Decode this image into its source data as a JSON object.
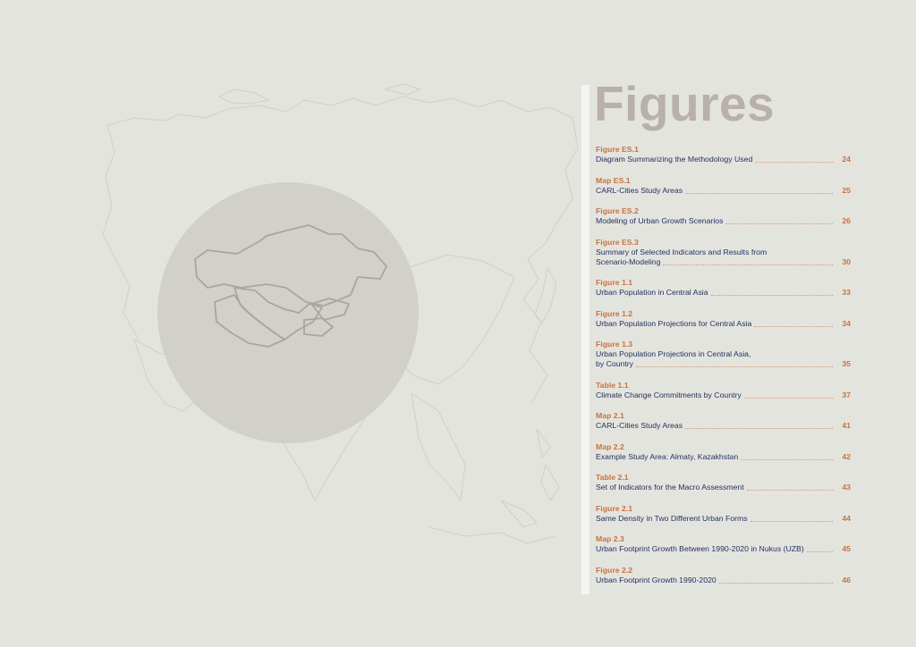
{
  "heading": "Figures",
  "colors": {
    "background": "#e4e4df",
    "label": "#c8733f",
    "title_text": "#1f2f5c",
    "heading": "#b9b0aa"
  },
  "entries": [
    {
      "label": "Figure ES.1",
      "lines": [
        "Diagram Summarizing the Methodology Used"
      ],
      "page": "24"
    },
    {
      "label": "Map ES.1",
      "lines": [
        "CARL-Cities Study Areas"
      ],
      "page": "25"
    },
    {
      "label": "Figure ES.2",
      "lines": [
        "Modeling of Urban Growth Scenarios"
      ],
      "page": "26"
    },
    {
      "label": "Figure ES.3",
      "lines": [
        "Summary of Selected Indicators and Results from",
        "Scenario-Modeling"
      ],
      "page": "30"
    },
    {
      "label": "Figure 1.1",
      "lines": [
        "Urban Population in Central Asia"
      ],
      "page": "33"
    },
    {
      "label": "Figure 1.2",
      "lines": [
        "Urban Population Projections for Central Asia"
      ],
      "page": "34"
    },
    {
      "label": "Figure 1.3",
      "lines": [
        "Urban Population Projections in Central Asia,",
        "by Country"
      ],
      "page": "35"
    },
    {
      "label": "Table 1.1",
      "lines": [
        "Climate Change Commitments by Country"
      ],
      "page": "37"
    },
    {
      "label": "Map 2.1",
      "lines": [
        "CARL-Cities Study Areas"
      ],
      "page": "41"
    },
    {
      "label": "Map 2.2",
      "lines": [
        "Example Study Area: Almaty, Kazakhstan"
      ],
      "page": "42"
    },
    {
      "label": "Table 2.1",
      "lines": [
        "Set of Indicators for the Macro Assessment"
      ],
      "page": "43"
    },
    {
      "label": "Figure 2.1",
      "lines": [
        "Same Density in Two Different Urban Forms"
      ],
      "page": "44"
    },
    {
      "label": "Map 2.3",
      "lines": [
        "Urban Footprint Growth Between 1990-2020 in Nukus (UZB)"
      ],
      "page": "45"
    },
    {
      "label": "Figure 2.2",
      "lines": [
        "Urban Footprint Growth 1990-2020"
      ],
      "page": "46"
    }
  ]
}
